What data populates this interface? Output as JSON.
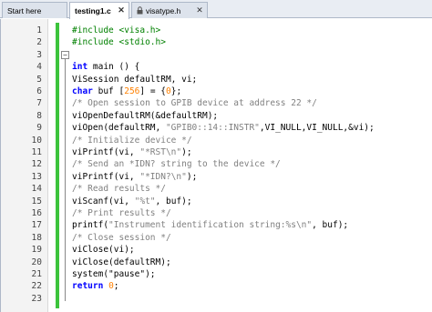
{
  "tabs": [
    {
      "label": "Start here",
      "active": false,
      "closable": false,
      "locked": false
    },
    {
      "label": "testing1.c",
      "active": true,
      "closable": true,
      "locked": false
    },
    {
      "label": "visatype.h",
      "active": false,
      "closable": true,
      "locked": true
    }
  ],
  "icons": {
    "close": "close-icon",
    "lock": "lock-icon",
    "fold": "fold-minus-icon"
  },
  "colors": {
    "keyword": "#0000ff",
    "preprocessor": "#008000",
    "comment": "#808080",
    "string": "#808080",
    "number": "#ff8000",
    "change_bar": "#3cc43c"
  },
  "lines": [
    {
      "n": "1",
      "tokens": [
        {
          "t": "#include <visa.h>",
          "c": "pp"
        }
      ]
    },
    {
      "n": "2",
      "tokens": [
        {
          "t": "#include <stdio.h>",
          "c": "pp"
        }
      ]
    },
    {
      "n": "3",
      "tokens": []
    },
    {
      "n": "4",
      "tokens": [
        {
          "t": "int",
          "c": "kw"
        },
        {
          "t": " main () {",
          "c": "plain"
        }
      ]
    },
    {
      "n": "5",
      "tokens": [
        {
          "t": "ViSession defaultRM, vi;",
          "c": "plain"
        }
      ]
    },
    {
      "n": "6",
      "tokens": [
        {
          "t": "char",
          "c": "kw"
        },
        {
          "t": " buf [",
          "c": "plain"
        },
        {
          "t": "256",
          "c": "num"
        },
        {
          "t": "] = {",
          "c": "plain"
        },
        {
          "t": "0",
          "c": "num"
        },
        {
          "t": "};",
          "c": "plain"
        }
      ]
    },
    {
      "n": "7",
      "tokens": [
        {
          "t": "/* Open session to GPIB device at address 22 */",
          "c": "cm"
        }
      ]
    },
    {
      "n": "8",
      "tokens": [
        {
          "t": "viOpenDefaultRM(&defaultRM);",
          "c": "plain"
        }
      ]
    },
    {
      "n": "9",
      "tokens": [
        {
          "t": "viOpen(defaultRM, ",
          "c": "plain"
        },
        {
          "t": "\"GPIB0::14::INSTR\"",
          "c": "str"
        },
        {
          "t": ",VI_NULL,VI_NULL,&vi);",
          "c": "plain"
        }
      ]
    },
    {
      "n": "10",
      "tokens": [
        {
          "t": "/* Initialize device */",
          "c": "cm"
        }
      ]
    },
    {
      "n": "11",
      "tokens": [
        {
          "t": "viPrintf(vi, ",
          "c": "plain"
        },
        {
          "t": "\"*RST\\n\"",
          "c": "str"
        },
        {
          "t": ");",
          "c": "plain"
        }
      ]
    },
    {
      "n": "12",
      "tokens": [
        {
          "t": "/* Send an *IDN? string to the device */",
          "c": "cm"
        }
      ]
    },
    {
      "n": "13",
      "tokens": [
        {
          "t": "viPrintf(vi, ",
          "c": "plain"
        },
        {
          "t": "\"*IDN?\\n\"",
          "c": "str"
        },
        {
          "t": ");",
          "c": "plain"
        }
      ]
    },
    {
      "n": "14",
      "tokens": [
        {
          "t": "/* Read results */",
          "c": "cm"
        }
      ]
    },
    {
      "n": "15",
      "tokens": [
        {
          "t": "viScanf(vi, ",
          "c": "plain"
        },
        {
          "t": "\"%t\"",
          "c": "str"
        },
        {
          "t": ", buf);",
          "c": "plain"
        }
      ]
    },
    {
      "n": "16",
      "tokens": [
        {
          "t": "/* Print results */",
          "c": "cm"
        }
      ]
    },
    {
      "n": "17",
      "tokens": [
        {
          "t": "printf(",
          "c": "plain"
        },
        {
          "t": "\"Instrument identification string:%s\\n\"",
          "c": "str"
        },
        {
          "t": ", buf);",
          "c": "plain"
        }
      ]
    },
    {
      "n": "18",
      "tokens": [
        {
          "t": "/* Close session */",
          "c": "cm"
        }
      ]
    },
    {
      "n": "19",
      "tokens": [
        {
          "t": "viClose(vi);",
          "c": "plain"
        }
      ]
    },
    {
      "n": "20",
      "tokens": [
        {
          "t": "viClose(defaultRM);",
          "c": "plain"
        }
      ]
    },
    {
      "n": "21",
      "tokens": [
        {
          "t": "system(\"pause\");",
          "c": "plain"
        }
      ]
    },
    {
      "n": "22",
      "tokens": [
        {
          "t": "return",
          "c": "kw"
        },
        {
          "t": " ",
          "c": "plain"
        },
        {
          "t": "0",
          "c": "num"
        },
        {
          "t": ";",
          "c": "plain"
        }
      ]
    },
    {
      "n": "23",
      "tokens": []
    }
  ]
}
